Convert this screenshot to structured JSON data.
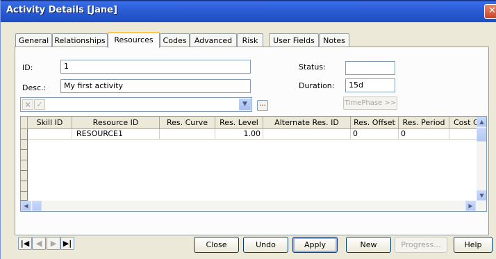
{
  "window": {
    "title": "Activity Details [Jane]"
  },
  "tabs": [
    "General",
    "Relationships",
    "Resources",
    "Codes",
    "Advanced",
    "Risk",
    "User Fields",
    "Notes"
  ],
  "active_tab": "Resources",
  "form": {
    "id_label": "ID:",
    "id_value": "1",
    "desc_label": "Desc.:",
    "desc_value": "My first activity",
    "status_label": "Status:",
    "status_value": "",
    "duration_label": "Duration:",
    "duration_value": "15d"
  },
  "toolbar": {
    "cancel_glyph": "✕",
    "confirm_glyph": "✓",
    "ellipsis_label": "...",
    "timephase_label": "TimePhase >>"
  },
  "grid": {
    "columns": [
      "Skill ID",
      "Resource ID",
      "Res. Curve",
      "Res. Level",
      "Alternate Res. ID",
      "Res. Offset",
      "Res. Period",
      "Cost C"
    ],
    "rows": [
      [
        "",
        "RESOURCE1",
        "",
        "1.00",
        "",
        "0",
        "0",
        ""
      ]
    ]
  },
  "buttons": {
    "close": "Close",
    "undo": "Undo",
    "apply": "Apply",
    "new": "New",
    "progress": "Progress...",
    "help": "Help"
  },
  "nav": {
    "first": "first-record-icon",
    "prev": "prev-record-icon",
    "next": "next-record-icon",
    "last": "last-record-icon"
  },
  "colors": {
    "title_bar": "#2455cc",
    "tab_highlight": "#ffc83c",
    "dialog_bg": "#ece9d8"
  }
}
